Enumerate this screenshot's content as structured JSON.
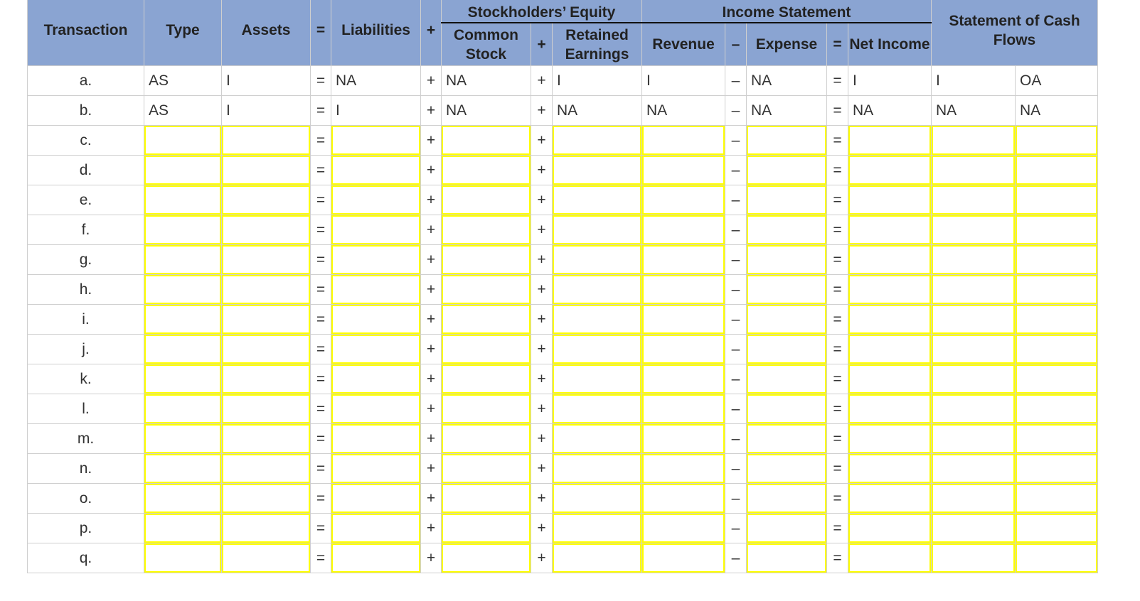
{
  "headers": {
    "transaction": "Transaction",
    "type": "Type",
    "assets": "Assets",
    "eq": "=",
    "liabilities": "Liabilities",
    "plus": "+",
    "stockholders_equity": "Stockholders’ Equity",
    "common_stock": "Common Stock",
    "retained_earnings": "Retained Earnings",
    "income_statement": "Income Statement",
    "revenue": "Revenue",
    "minus": "–",
    "expense": "Expense",
    "net_income": "Net Income",
    "cash_flows": "Statement of Cash Flows"
  },
  "operators": {
    "eq": "=",
    "plus": "+",
    "minus": "–"
  },
  "rows": [
    {
      "label": "a.",
      "type": "AS",
      "assets": "I",
      "liabilities": "NA",
      "common_stock": "NA",
      "retained_earnings": "I",
      "revenue": "I",
      "expense": "NA",
      "net_income": "I",
      "cash_amount": "I",
      "cash_activity": "OA"
    },
    {
      "label": "b.",
      "type": "AS",
      "assets": "I",
      "liabilities": "I",
      "common_stock": "NA",
      "retained_earnings": "NA",
      "revenue": "NA",
      "expense": "NA",
      "net_income": "NA",
      "cash_amount": "NA",
      "cash_activity": "NA"
    },
    {
      "label": "c."
    },
    {
      "label": "d."
    },
    {
      "label": "e."
    },
    {
      "label": "f."
    },
    {
      "label": "g."
    },
    {
      "label": "h."
    },
    {
      "label": "i."
    },
    {
      "label": "j."
    },
    {
      "label": "k."
    },
    {
      "label": "l."
    },
    {
      "label": "m."
    },
    {
      "label": "n."
    },
    {
      "label": "o."
    },
    {
      "label": "p."
    },
    {
      "label": "q."
    }
  ]
}
